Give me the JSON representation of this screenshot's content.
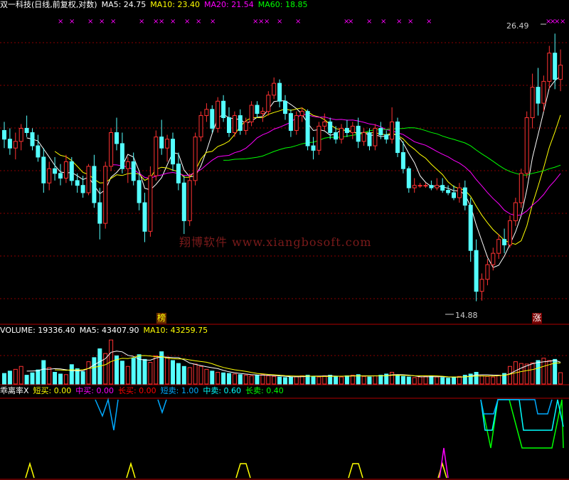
{
  "header": {
    "title": "双一科技(日线,前复权,对数)",
    "items": [
      {
        "label": "MA5: 24.75",
        "color": "#ffffff"
      },
      {
        "label": "MA10: 23.40",
        "color": "#ffff00"
      },
      {
        "label": "MA20: 21.54",
        "color": "#ff00ff"
      },
      {
        "label": "MA60: 18.85",
        "color": "#00ff00"
      }
    ]
  },
  "volume_header": {
    "items": [
      {
        "label": "VOLUME: 19336.40",
        "color": "#ffffff"
      },
      {
        "label": "MA5: 43407.90",
        "color": "#ffffff"
      },
      {
        "label": "MA10: 43259.75",
        "color": "#ffff00"
      }
    ]
  },
  "indicator_header": {
    "name": "乖离率X",
    "items": [
      {
        "label": "短买: 0.00",
        "color": "#ffff00"
      },
      {
        "label": "中买: 0.00",
        "color": "#ff00ff"
      },
      {
        "label": "长买: 0.00",
        "color": "#ff0000"
      },
      {
        "label": "短卖: 1.00",
        "color": "#00aaff"
      },
      {
        "label": "中卖: 0.60",
        "color": "#00ffff"
      },
      {
        "label": "长卖: 0.40",
        "color": "#00ff00"
      }
    ]
  },
  "annotations": {
    "high": "26.49",
    "low": "14.88"
  },
  "markers": {
    "left": "榜",
    "right": "涨"
  },
  "watermark": "翔博软件 www.xiangbosoft.com",
  "colors": {
    "up": "#ff3232",
    "down": "#54ffff",
    "ma5": "#ffffff",
    "ma10": "#ffff00",
    "ma20": "#ff00ff",
    "ma60": "#00ff00",
    "grid": "#8b0000"
  },
  "chart_data": [
    {
      "type": "candlestick",
      "title": "双一科技(日线,前复权,对数)",
      "note": "approximate OHLC read from screenshot, 100 trading days",
      "ohlc": [
        [
          21.5,
          21.9,
          20.7,
          21.1
        ],
        [
          21.1,
          21.6,
          20.4,
          20.7
        ],
        [
          20.7,
          21.4,
          20.2,
          21.0
        ],
        [
          21.0,
          21.8,
          20.6,
          21.6
        ],
        [
          21.6,
          22.2,
          21.2,
          21.4
        ],
        [
          21.4,
          21.6,
          20.6,
          20.8
        ],
        [
          20.8,
          21.3,
          20.1,
          20.3
        ],
        [
          20.3,
          20.7,
          18.8,
          19.2
        ],
        [
          19.2,
          20.1,
          18.9,
          19.8
        ],
        [
          19.8,
          20.3,
          19.3,
          19.6
        ],
        [
          19.6,
          20.0,
          19.1,
          19.4
        ],
        [
          19.4,
          20.4,
          19.2,
          20.1
        ],
        [
          20.1,
          20.3,
          19.1,
          19.3
        ],
        [
          19.3,
          19.6,
          18.8,
          19.1
        ],
        [
          19.1,
          19.5,
          18.6,
          18.8
        ],
        [
          18.8,
          20.0,
          18.7,
          19.9
        ],
        [
          19.9,
          20.4,
          18.2,
          18.4
        ],
        [
          18.4,
          19.0,
          17.0,
          17.6
        ],
        [
          17.6,
          20.1,
          17.4,
          19.9
        ],
        [
          19.9,
          21.6,
          19.7,
          21.4
        ],
        [
          21.4,
          22.1,
          20.6,
          20.9
        ],
        [
          20.9,
          21.4,
          19.6,
          19.8
        ],
        [
          19.8,
          20.3,
          19.2,
          20.1
        ],
        [
          20.1,
          20.5,
          19.1,
          19.3
        ],
        [
          19.3,
          19.6,
          18.1,
          18.4
        ],
        [
          18.4,
          18.8,
          16.9,
          17.3
        ],
        [
          17.3,
          19.9,
          17.1,
          19.5
        ],
        [
          19.5,
          21.5,
          19.3,
          21.2
        ],
        [
          21.2,
          22.0,
          20.4,
          20.7
        ],
        [
          20.7,
          21.3,
          20.1,
          21.1
        ],
        [
          21.1,
          21.4,
          19.7,
          20.0
        ],
        [
          20.0,
          20.5,
          18.9,
          19.2
        ],
        [
          19.2,
          19.5,
          17.2,
          17.7
        ],
        [
          17.7,
          19.6,
          17.5,
          19.3
        ],
        [
          19.3,
          21.4,
          19.1,
          21.2
        ],
        [
          21.2,
          22.4,
          21.0,
          22.2
        ],
        [
          22.2,
          22.8,
          21.9,
          22.5
        ],
        [
          22.5,
          22.7,
          21.4,
          21.6
        ],
        [
          21.6,
          23.1,
          21.4,
          22.9
        ],
        [
          22.9,
          23.2,
          21.9,
          22.1
        ],
        [
          22.1,
          22.6,
          21.2,
          21.4
        ],
        [
          21.4,
          22.4,
          21.2,
          22.2
        ],
        [
          22.2,
          22.5,
          21.3,
          21.5
        ],
        [
          21.5,
          22.1,
          21.3,
          21.9
        ],
        [
          21.9,
          22.9,
          21.7,
          22.7
        ],
        [
          22.7,
          22.9,
          22.1,
          22.3
        ],
        [
          22.3,
          22.6,
          21.9,
          22.4
        ],
        [
          22.4,
          23.4,
          22.2,
          23.2
        ],
        [
          23.2,
          24.1,
          23.0,
          23.8
        ],
        [
          23.8,
          24.0,
          22.6,
          22.9
        ],
        [
          22.9,
          23.2,
          22.0,
          22.3
        ],
        [
          22.3,
          22.5,
          21.2,
          21.5
        ],
        [
          21.5,
          22.4,
          21.3,
          22.2
        ],
        [
          22.2,
          22.6,
          21.9,
          22.4
        ],
        [
          22.4,
          22.5,
          20.6,
          20.8
        ],
        [
          20.8,
          21.2,
          20.2,
          20.6
        ],
        [
          20.6,
          21.9,
          20.4,
          21.7
        ],
        [
          21.7,
          22.3,
          21.5,
          21.9
        ],
        [
          21.9,
          22.1,
          21.1,
          21.4
        ],
        [
          21.4,
          21.7,
          20.9,
          21.1
        ],
        [
          21.1,
          21.8,
          20.9,
          21.6
        ],
        [
          21.6,
          22.0,
          21.2,
          21.4
        ],
        [
          21.4,
          21.9,
          21.1,
          21.7
        ],
        [
          21.7,
          22.1,
          20.7,
          21.0
        ],
        [
          21.0,
          21.6,
          20.8,
          21.4
        ],
        [
          21.4,
          21.6,
          20.6,
          20.8
        ],
        [
          20.8,
          21.8,
          20.6,
          21.6
        ],
        [
          21.6,
          21.9,
          21.1,
          21.3
        ],
        [
          21.3,
          21.5,
          20.9,
          21.1
        ],
        [
          21.1,
          22.6,
          20.9,
          21.9
        ],
        [
          21.9,
          22.1,
          20.3,
          20.5
        ],
        [
          20.5,
          21.0,
          19.6,
          19.8
        ],
        [
          19.8,
          19.9,
          18.8,
          19.0
        ],
        [
          19.0,
          19.4,
          18.8,
          19.1
        ],
        [
          19.1,
          19.2,
          19.0,
          19.1
        ],
        [
          19.1,
          19.2,
          19.0,
          19.1
        ],
        [
          19.1,
          19.3,
          18.9,
          19.0
        ],
        [
          19.0,
          19.4,
          18.9,
          19.1
        ],
        [
          19.1,
          19.4,
          18.8,
          18.9
        ],
        [
          18.9,
          19.1,
          18.7,
          18.8
        ],
        [
          18.8,
          19.1,
          18.5,
          18.6
        ],
        [
          18.6,
          19.2,
          18.4,
          19.0
        ],
        [
          19.0,
          19.3,
          18.1,
          18.3
        ],
        [
          18.3,
          18.6,
          16.2,
          16.6
        ],
        [
          16.6,
          17.0,
          14.88,
          15.2
        ],
        [
          15.2,
          15.8,
          14.9,
          15.6
        ],
        [
          15.6,
          16.3,
          15.4,
          16.1
        ],
        [
          16.1,
          16.7,
          15.9,
          16.5
        ],
        [
          16.5,
          17.2,
          16.3,
          17.0
        ],
        [
          17.0,
          17.4,
          16.5,
          16.8
        ],
        [
          16.8,
          17.9,
          16.7,
          17.7
        ],
        [
          17.7,
          18.6,
          17.5,
          18.4
        ],
        [
          18.4,
          19.8,
          18.2,
          19.6
        ],
        [
          19.6,
          22.4,
          19.4,
          22.1
        ],
        [
          22.1,
          24.3,
          21.6,
          23.6
        ],
        [
          23.6,
          24.6,
          22.2,
          22.8
        ],
        [
          22.8,
          24.2,
          22.4,
          23.9
        ],
        [
          23.9,
          25.8,
          23.5,
          25.4
        ],
        [
          25.4,
          26.49,
          23.5,
          24.0
        ],
        [
          24.0,
          25.6,
          23.4,
          24.75
        ]
      ],
      "volume": [
        18,
        22,
        25,
        30,
        15,
        19,
        24,
        40,
        28,
        20,
        17,
        16,
        33,
        26,
        21,
        38,
        45,
        60,
        52,
        75,
        48,
        39,
        30,
        44,
        50,
        42,
        37,
        48,
        55,
        46,
        40,
        35,
        30,
        28,
        34,
        30,
        25,
        22,
        20,
        19,
        18,
        17,
        16,
        15,
        14,
        15,
        16,
        14,
        13,
        12,
        11,
        12,
        13,
        14,
        15,
        13,
        12,
        14,
        15,
        13,
        12,
        14,
        15,
        16,
        13,
        12,
        14,
        15,
        17,
        20,
        14,
        13,
        12,
        11,
        12,
        13,
        14,
        12,
        11,
        10,
        12,
        13,
        15,
        17,
        20,
        14,
        13,
        12,
        15,
        18,
        30,
        38,
        35,
        34,
        36,
        40,
        44,
        40,
        42,
        19.3364
      ]
    },
    {
      "type": "line",
      "title": "乖离率X",
      "series": [
        {
          "name": "短卖",
          "values": [
            1.0
          ]
        },
        {
          "name": "中卖",
          "values": [
            0.6
          ]
        },
        {
          "name": "长卖",
          "values": [
            0.4
          ]
        }
      ]
    }
  ]
}
